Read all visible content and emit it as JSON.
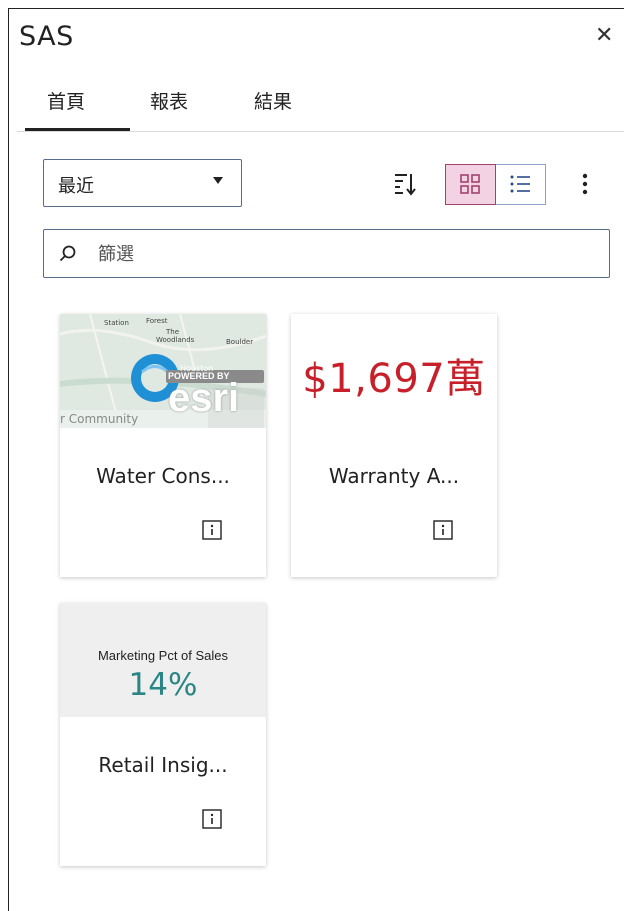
{
  "app": {
    "title": "SAS",
    "close_glyph": "✕"
  },
  "tabs": [
    {
      "label": "首頁",
      "active": true
    },
    {
      "label": "報表",
      "active": false
    },
    {
      "label": "結果",
      "active": false
    }
  ],
  "toolbar": {
    "sort_select": {
      "value": "最近"
    },
    "sort_icon": "sort-icon",
    "view_tile_icon": "grid-view-icon",
    "view_list_icon": "list-view-icon",
    "view_tile_selected": true,
    "more_icon": "more-vertical-icon",
    "accent_color": "#a0436f"
  },
  "filter": {
    "placeholder": "篩選",
    "value": ""
  },
  "cards": [
    {
      "title": "Water Cons...",
      "thumb_type": "map",
      "map_labels": [
        "Station",
        "Forest",
        "The",
        "Woodlands",
        "Boulder",
        "Houston"
      ],
      "map_attribution": "r Community",
      "map_logo_text": "esri",
      "map_logo_powered": "POWERED BY"
    },
    {
      "title": "Warranty A...",
      "thumb_type": "kpi",
      "kpi_value": "$1,697萬",
      "kpi_color": "#c8202a"
    },
    {
      "title": "Retail Insig...",
      "thumb_type": "kpi-label",
      "kpi_label": "Marketing Pct of Sales",
      "kpi_value": "14%",
      "kpi_color": "#2b8585"
    }
  ]
}
